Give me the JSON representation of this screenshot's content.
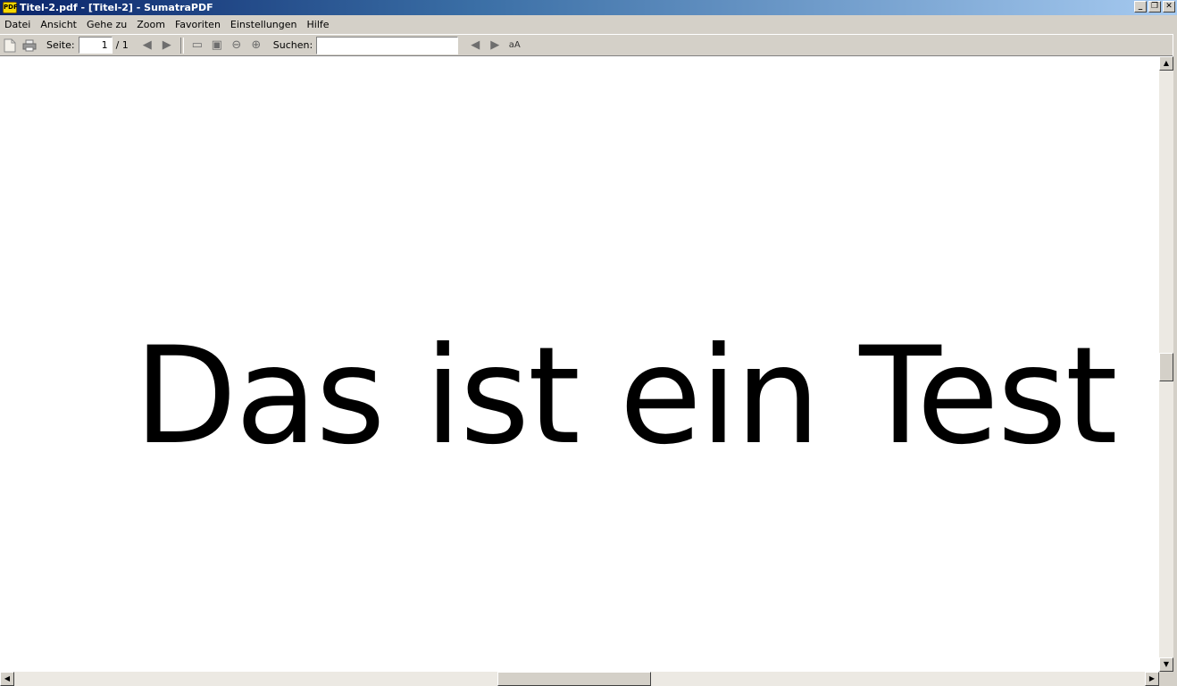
{
  "window": {
    "title": "Titel-2.pdf - [Titel-2] - SumatraPDF",
    "app_icon_text": "PDF",
    "minimize_glyph": "_",
    "maximize_glyph": "❐",
    "close_glyph": "✕"
  },
  "menu": {
    "items": [
      {
        "label": "Datei"
      },
      {
        "label": "Ansicht"
      },
      {
        "label": "Gehe zu"
      },
      {
        "label": "Zoom"
      },
      {
        "label": "Favoriten"
      },
      {
        "label": "Einstellungen"
      },
      {
        "label": "Hilfe"
      }
    ]
  },
  "toolbar": {
    "open_icon": "open-file-icon",
    "print_icon": "print-icon",
    "page_label": "Seite:",
    "current_page": "1",
    "page_total": "/ 1",
    "prev_page_glyph": "◀",
    "next_page_glyph": "▶",
    "fit_page_glyph": "▭",
    "fit_width_glyph": "▣",
    "zoom_out_glyph": "⊖",
    "zoom_in_glyph": "⊕",
    "search_label": "Suchen:",
    "search_value": "",
    "search_prev_glyph": "◀",
    "search_next_glyph": "▶",
    "match_case_glyph": "aA"
  },
  "document": {
    "text": "Das ist ein Test"
  },
  "scrollbars": {
    "up_glyph": "▲",
    "down_glyph": "▼",
    "left_glyph": "◀",
    "right_glyph": "▶"
  }
}
